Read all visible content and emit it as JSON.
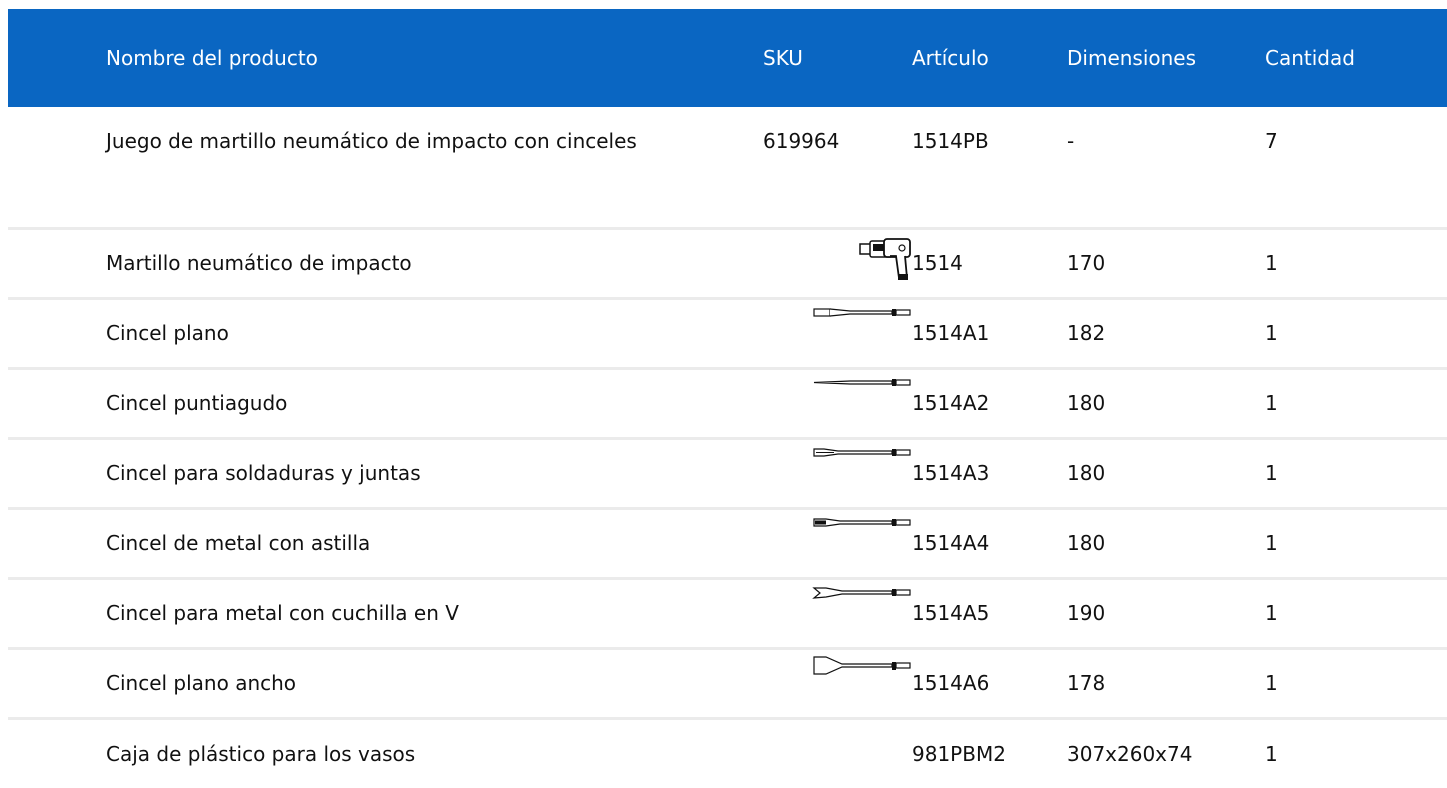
{
  "table": {
    "headers": {
      "name": "Nombre del producto",
      "sku": "SKU",
      "article": "Artículo",
      "dimensions": "Dimensiones",
      "quantity": "Cantidad"
    },
    "rows": [
      {
        "name": "Juego de martillo neumático de impacto con cinceles",
        "sku": "619964",
        "icon": "",
        "article": "1514PB",
        "dimensions": "-",
        "quantity": "7"
      },
      {
        "name": "Martillo neumático de impacto",
        "sku": "",
        "icon": "air-hammer-icon",
        "article": "1514",
        "dimensions": "170",
        "quantity": "1"
      },
      {
        "name": "Cincel plano",
        "sku": "",
        "icon": "flat-chisel-icon",
        "article": "1514A1",
        "dimensions": "182",
        "quantity": "1"
      },
      {
        "name": "Cincel puntiagudo",
        "sku": "",
        "icon": "pointed-chisel-icon",
        "article": "1514A2",
        "dimensions": "180",
        "quantity": "1"
      },
      {
        "name": "Cincel para soldaduras y juntas",
        "sku": "",
        "icon": "weld-chisel-icon",
        "article": "1514A3",
        "dimensions": "180",
        "quantity": "1"
      },
      {
        "name": "Cincel de metal con astilla",
        "sku": "",
        "icon": "splitting-chisel-icon",
        "article": "1514A4",
        "dimensions": "180",
        "quantity": "1"
      },
      {
        "name": "Cincel para metal con cuchilla en V",
        "sku": "",
        "icon": "v-blade-chisel-icon",
        "article": "1514A5",
        "dimensions": "190",
        "quantity": "1"
      },
      {
        "name": "Cincel plano ancho",
        "sku": "",
        "icon": "wide-flat-chisel-icon",
        "article": "1514A6",
        "dimensions": "178",
        "quantity": "1"
      },
      {
        "name": "Caja de plástico para los vasos",
        "sku": "",
        "icon": "",
        "article": "981PBM2",
        "dimensions": "307x260x74",
        "quantity": "1"
      }
    ]
  },
  "colors": {
    "header_bg": "#0a66c2",
    "header_text": "#ffffff",
    "row_divider": "#ebebeb"
  }
}
